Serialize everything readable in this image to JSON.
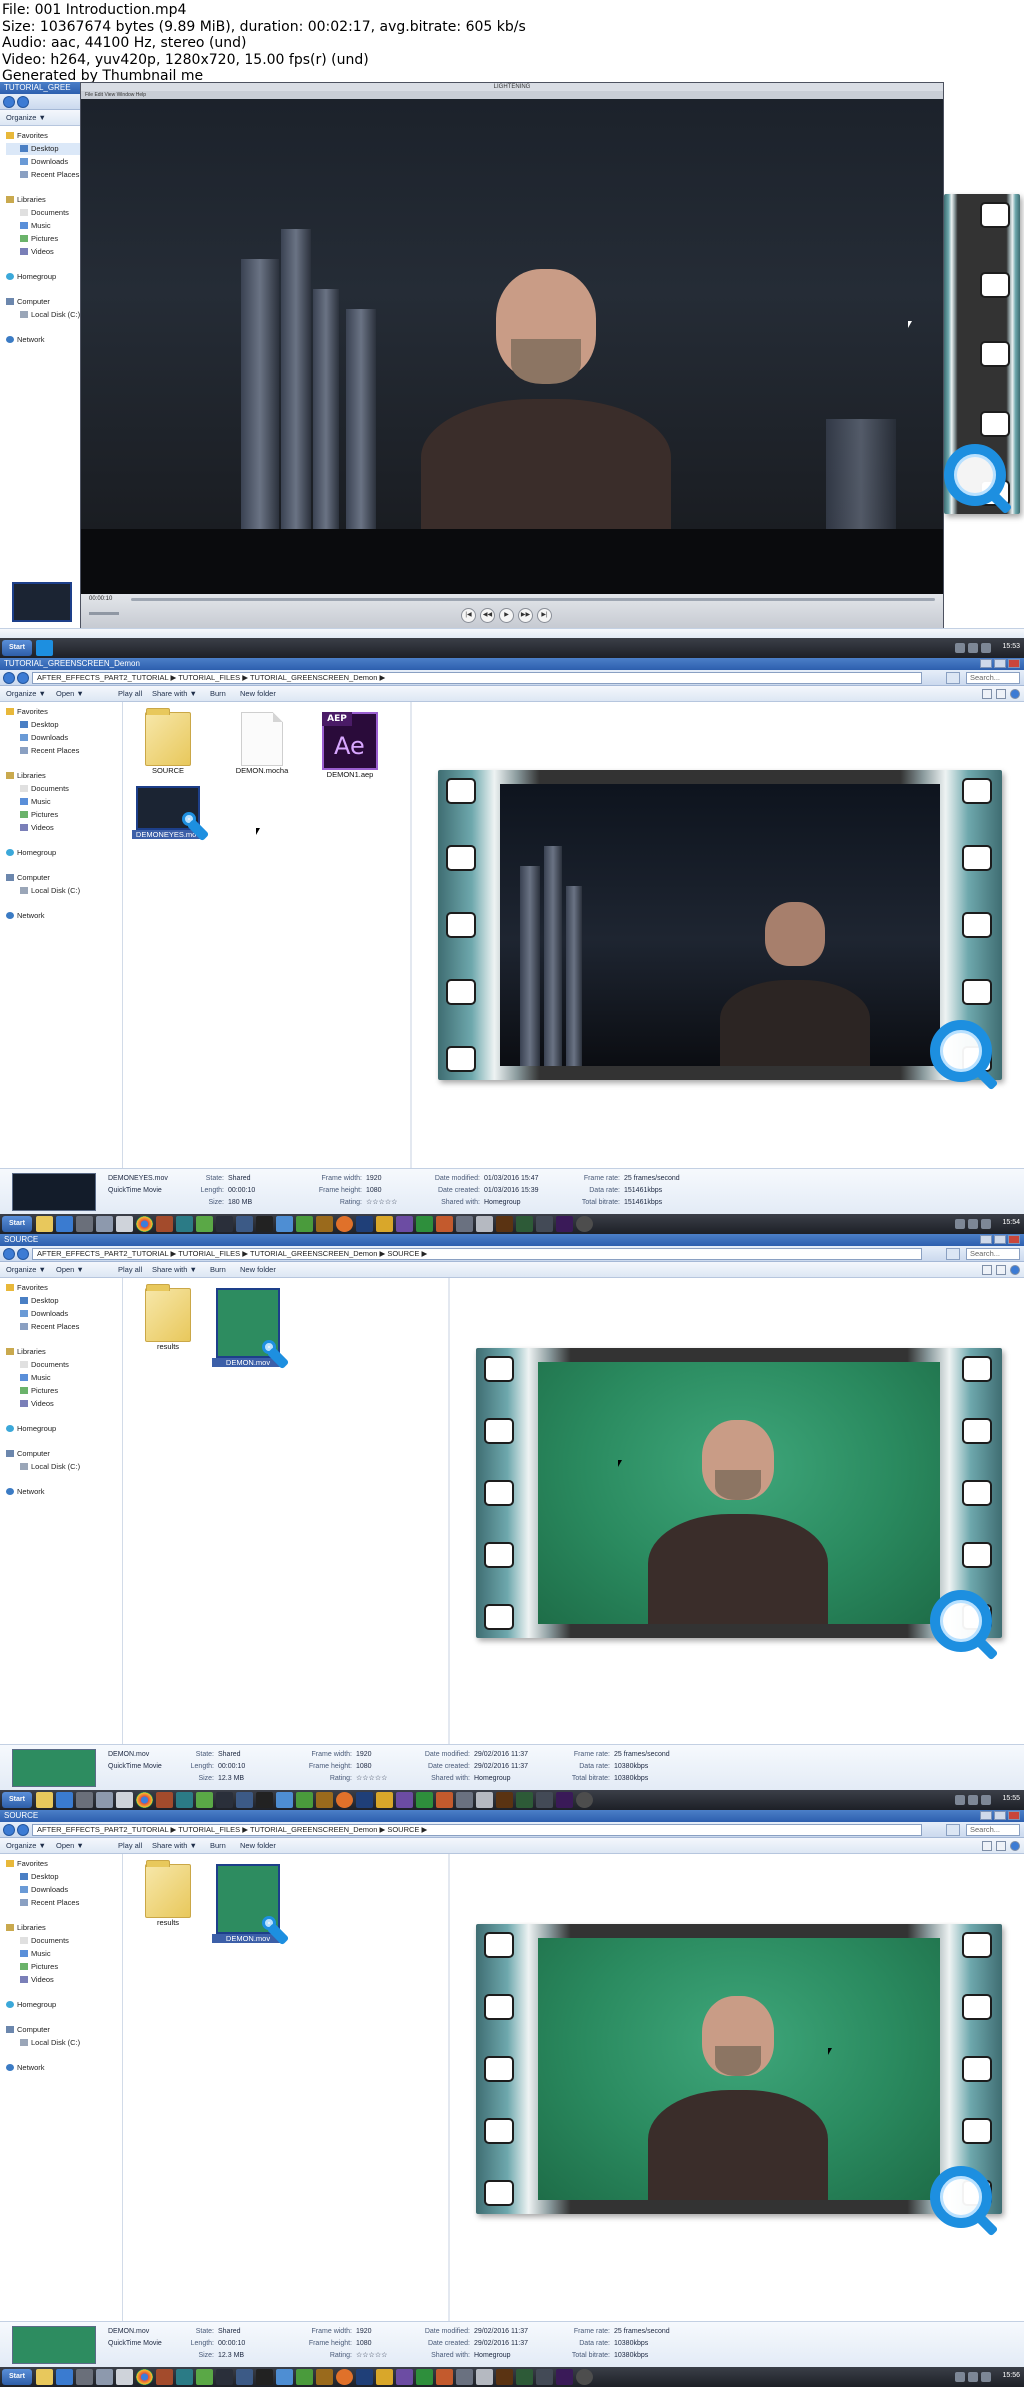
{
  "header": {
    "lines": [
      "File: 001 Introduction.mp4",
      "Size: 10367674 bytes (9.89 MiB), duration: 00:02:17, avg.bitrate: 605 kb/s",
      "Audio: aac, 44100 Hz, stereo (und)",
      "Video: h264, yuv420p, 1280x720, 15.00 fps(r) (und)",
      "Generated by Thumbnail me"
    ]
  },
  "nav": {
    "favorites": "Favorites",
    "desktop": "Desktop",
    "downloads": "Downloads",
    "recent": "Recent Places",
    "libraries": "Libraries",
    "documents": "Documents",
    "music": "Music",
    "pictures": "Pictures",
    "videos": "Videos",
    "homegroup": "Homegroup",
    "computer": "Computer",
    "local_disk": "Local Disk (C:)",
    "network": "Network"
  },
  "toolbar": {
    "organize": "Organize ▼",
    "open": "Open ▼",
    "play_all": "Play all",
    "share_with": "Share with ▼",
    "burn": "Burn",
    "new_folder": "New folder"
  },
  "search_placeholder": "Search...",
  "taskbar": {
    "start": "Start"
  },
  "frame1": {
    "window_title": "TUTORIAL_GREE",
    "player_title": "LIGHTENING",
    "player_menu": "File  Edit  View  Window  Help",
    "timecode": "00:00:10",
    "buttons": [
      "|◀",
      "◀◀",
      "▶",
      "▶▶",
      "▶|"
    ],
    "clock": "15:53"
  },
  "frame2": {
    "window_title": "TUTORIAL_GREENSCREEN_Demon",
    "address": "AFTER_EFFECTS_PART2_TUTORIAL ▶ TUTORIAL_FILES ▶ TUTORIAL_GREENSCREEN_Demon ▶",
    "items": [
      {
        "label": "SOURCE"
      },
      {
        "label": "DEMON.mocha"
      },
      {
        "label": "DEMON1.aep",
        "badge": "AEP",
        "glyph": "Ae"
      },
      {
        "label": "DEMONEYES.mov"
      }
    ],
    "details": {
      "name": "DEMONEYES.mov",
      "type": "QuickTime Movie",
      "state_k": "State:",
      "state_v": "Shared",
      "length_k": "Length:",
      "length_v": "00:00:10",
      "size_k": "Size:",
      "size_v": "180 MB",
      "fw_k": "Frame width:",
      "fw_v": "1920",
      "fh_k": "Frame height:",
      "fh_v": "1080",
      "rating_k": "Rating:",
      "rating_v": "☆☆☆☆☆",
      "dm_k": "Date modified:",
      "dm_v": "01/03/2016 15:47",
      "dc_k": "Date created:",
      "dc_v": "01/03/2016 15:39",
      "sw_k": "Shared with:",
      "sw_v": "Homegroup",
      "fr_k": "Frame rate:",
      "fr_v": "25 frames/second",
      "dr_k": "Data rate:",
      "dr_v": "151461kbps",
      "tb_k": "Total bitrate:",
      "tb_v": "151461kbps"
    },
    "clock": "15:54"
  },
  "frame3": {
    "window_title": "SOURCE",
    "address": "AFTER_EFFECTS_PART2_TUTORIAL ▶ TUTORIAL_FILES ▶ TUTORIAL_GREENSCREEN_Demon ▶ SOURCE ▶",
    "items": [
      {
        "label": "results"
      },
      {
        "label": "DEMON.mov"
      }
    ],
    "details": {
      "name": "DEMON.mov",
      "type": "QuickTime Movie",
      "state_k": "State:",
      "state_v": "Shared",
      "length_k": "Length:",
      "length_v": "00:00:10",
      "size_k": "Size:",
      "size_v": "12.3 MB",
      "fw_k": "Frame width:",
      "fw_v": "1920",
      "fh_k": "Frame height:",
      "fh_v": "1080",
      "rating_k": "Rating:",
      "rating_v": "☆☆☆☆☆",
      "dm_k": "Date modified:",
      "dm_v": "29/02/2016 11:37",
      "dc_k": "Date created:",
      "dc_v": "29/02/2016 11:37",
      "sw_k": "Shared with:",
      "sw_v": "Homegroup",
      "fr_k": "Frame rate:",
      "fr_v": "25 frames/second",
      "dr_k": "Data rate:",
      "dr_v": "10380kbps",
      "tb_k": "Total bitrate:",
      "tb_v": "10380kbps"
    },
    "clock": "15:55"
  },
  "frame4": {
    "window_title": "SOURCE",
    "address": "AFTER_EFFECTS_PART2_TUTORIAL ▶ TUTORIAL_FILES ▶ TUTORIAL_GREENSCREEN_Demon ▶ SOURCE ▶",
    "items": [
      {
        "label": "results"
      },
      {
        "label": "DEMON.mov"
      }
    ],
    "details": {
      "name": "DEMON.mov",
      "type": "QuickTime Movie",
      "state_k": "State:",
      "state_v": "Shared",
      "length_k": "Length:",
      "length_v": "00:00:10",
      "size_k": "Size:",
      "size_v": "12.3 MB",
      "fw_k": "Frame width:",
      "fw_v": "1920",
      "fh_k": "Frame height:",
      "fh_v": "1080",
      "rating_k": "Rating:",
      "rating_v": "☆☆☆☆☆",
      "dm_k": "Date modified:",
      "dm_v": "29/02/2016 11:37",
      "dc_k": "Date created:",
      "dc_v": "29/02/2016 11:37",
      "sw_k": "Shared with:",
      "sw_v": "Homegroup",
      "fr_k": "Frame rate:",
      "fr_v": "25 frames/second",
      "dr_k": "Data rate:",
      "dr_v": "10380kbps",
      "tb_k": "Total bitrate:",
      "tb_v": "10380kbps"
    },
    "clock": "15:56"
  },
  "colors": {
    "titlebar": "#2d5fae",
    "selection": "#3c5fa8",
    "greenscreen": "#2a8a5f",
    "quicktime": "#1d8fe0"
  }
}
